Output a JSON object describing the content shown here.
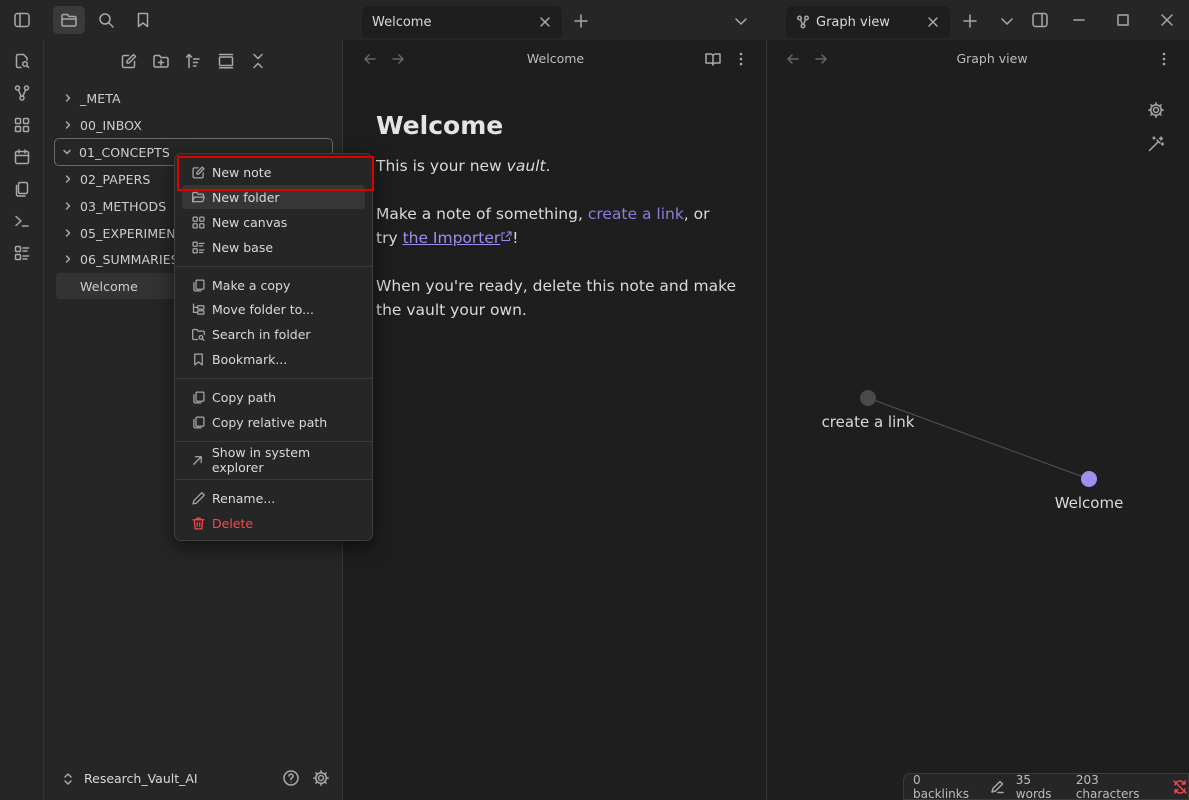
{
  "titlebar": {
    "tabs": [
      {
        "label": "Welcome"
      },
      {
        "label": "Graph view"
      }
    ]
  },
  "sidebar": {
    "items": [
      {
        "label": "_META",
        "type": "folder"
      },
      {
        "label": "00_INBOX",
        "type": "folder"
      },
      {
        "label": "01_CONCEPTS",
        "type": "folder",
        "state": "focused"
      },
      {
        "label": "02_PAPERS",
        "type": "folder"
      },
      {
        "label": "03_METHODS",
        "type": "folder"
      },
      {
        "label": "05_EXPERIMENTS",
        "type": "folder"
      },
      {
        "label": "06_SUMMARIES",
        "type": "folder"
      },
      {
        "label": "Welcome",
        "type": "file",
        "state": "active"
      }
    ],
    "vault_name": "Research_Vault_AI"
  },
  "context_menu": {
    "groups": [
      [
        {
          "label": "New note",
          "icon": "edit-icon"
        },
        {
          "label": "New folder",
          "icon": "folder-open-icon"
        },
        {
          "label": "New canvas",
          "icon": "canvas-icon"
        },
        {
          "label": "New base",
          "icon": "base-icon"
        }
      ],
      [
        {
          "label": "Make a copy",
          "icon": "copy-icon"
        },
        {
          "label": "Move folder to...",
          "icon": "folder-tree-icon"
        },
        {
          "label": "Search in folder",
          "icon": "folder-search-icon"
        },
        {
          "label": "Bookmark...",
          "icon": "bookmark-icon"
        }
      ],
      [
        {
          "label": "Copy path",
          "icon": "copy-icon"
        },
        {
          "label": "Copy relative path",
          "icon": "copy-icon"
        }
      ],
      [
        {
          "label": "Show in system explorer",
          "icon": "arrow-up-right-icon"
        }
      ],
      [
        {
          "label": "Rename...",
          "icon": "pencil-icon"
        },
        {
          "label": "Delete",
          "icon": "trash-icon",
          "danger": true
        }
      ]
    ]
  },
  "note": {
    "header_title": "Welcome",
    "title": "Welcome",
    "p1_prefix": "This is your new ",
    "p1_em": "vault",
    "p1_suffix": ".",
    "p2_a": "Make a note of something, ",
    "p2_link": "create a link",
    "p2_b": ", or",
    "p2_c": "try ",
    "p2_ext_link": "the Importer",
    "p2_d": "!",
    "p3_line1": "When you're ready, delete this note and make",
    "p3_line2": "the vault your own."
  },
  "graph": {
    "header_title": "Graph view",
    "nodes": [
      {
        "label": "create a link",
        "color": "#4a4a4a"
      },
      {
        "label": "Welcome",
        "color": "#a48df0"
      }
    ]
  },
  "statusbar": {
    "backlinks": "0 backlinks",
    "words": "35 words",
    "characters": "203 characters"
  },
  "colors": {
    "accent": "#8f7ed8",
    "danger": "#fb464c",
    "highlight_box": "#e00000"
  }
}
